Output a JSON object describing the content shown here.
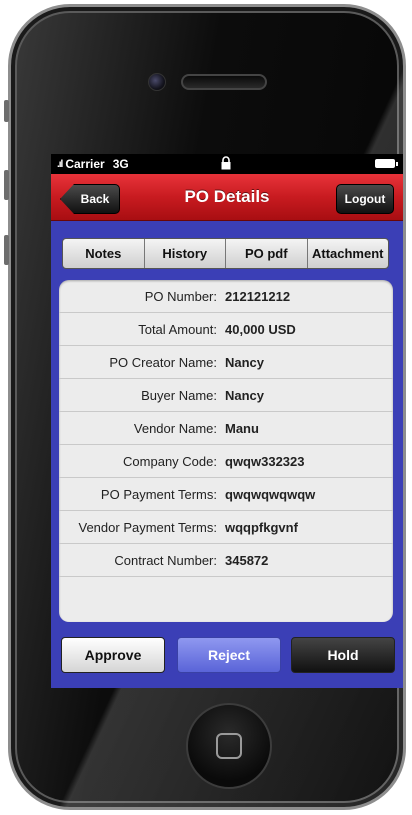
{
  "status_bar": {
    "signal": ".ıl",
    "carrier": "Carrier",
    "network": "3G"
  },
  "navbar": {
    "title": "PO Details",
    "back_label": "Back",
    "logout_label": "Logout"
  },
  "tabs": [
    {
      "label": "Notes"
    },
    {
      "label": "History"
    },
    {
      "label": "PO pdf"
    },
    {
      "label": "Attachment"
    }
  ],
  "details": [
    {
      "label": "PO Number:",
      "value": "212121212"
    },
    {
      "label": "Total Amount:",
      "value": "40,000 USD"
    },
    {
      "label": "PO Creator Name:",
      "value": "Nancy"
    },
    {
      "label": "Buyer Name:",
      "value": "Nancy"
    },
    {
      "label": "Vendor Name:",
      "value": "Manu"
    },
    {
      "label": "Company Code:",
      "value": "qwqw332323"
    },
    {
      "label": "PO Payment Terms:",
      "value": "qwqwqwqwqw"
    },
    {
      "label": "Vendor Payment Terms:",
      "value": "wqqpfkgvnf"
    },
    {
      "label": "Contract Number:",
      "value": "345872"
    }
  ],
  "actions": {
    "approve_label": "Approve",
    "reject_label": "Reject",
    "hold_label": "Hold"
  },
  "colors": {
    "navbar": "#c81b20",
    "screen_bg": "#3b3fb6",
    "reject": "#6a73e0"
  }
}
